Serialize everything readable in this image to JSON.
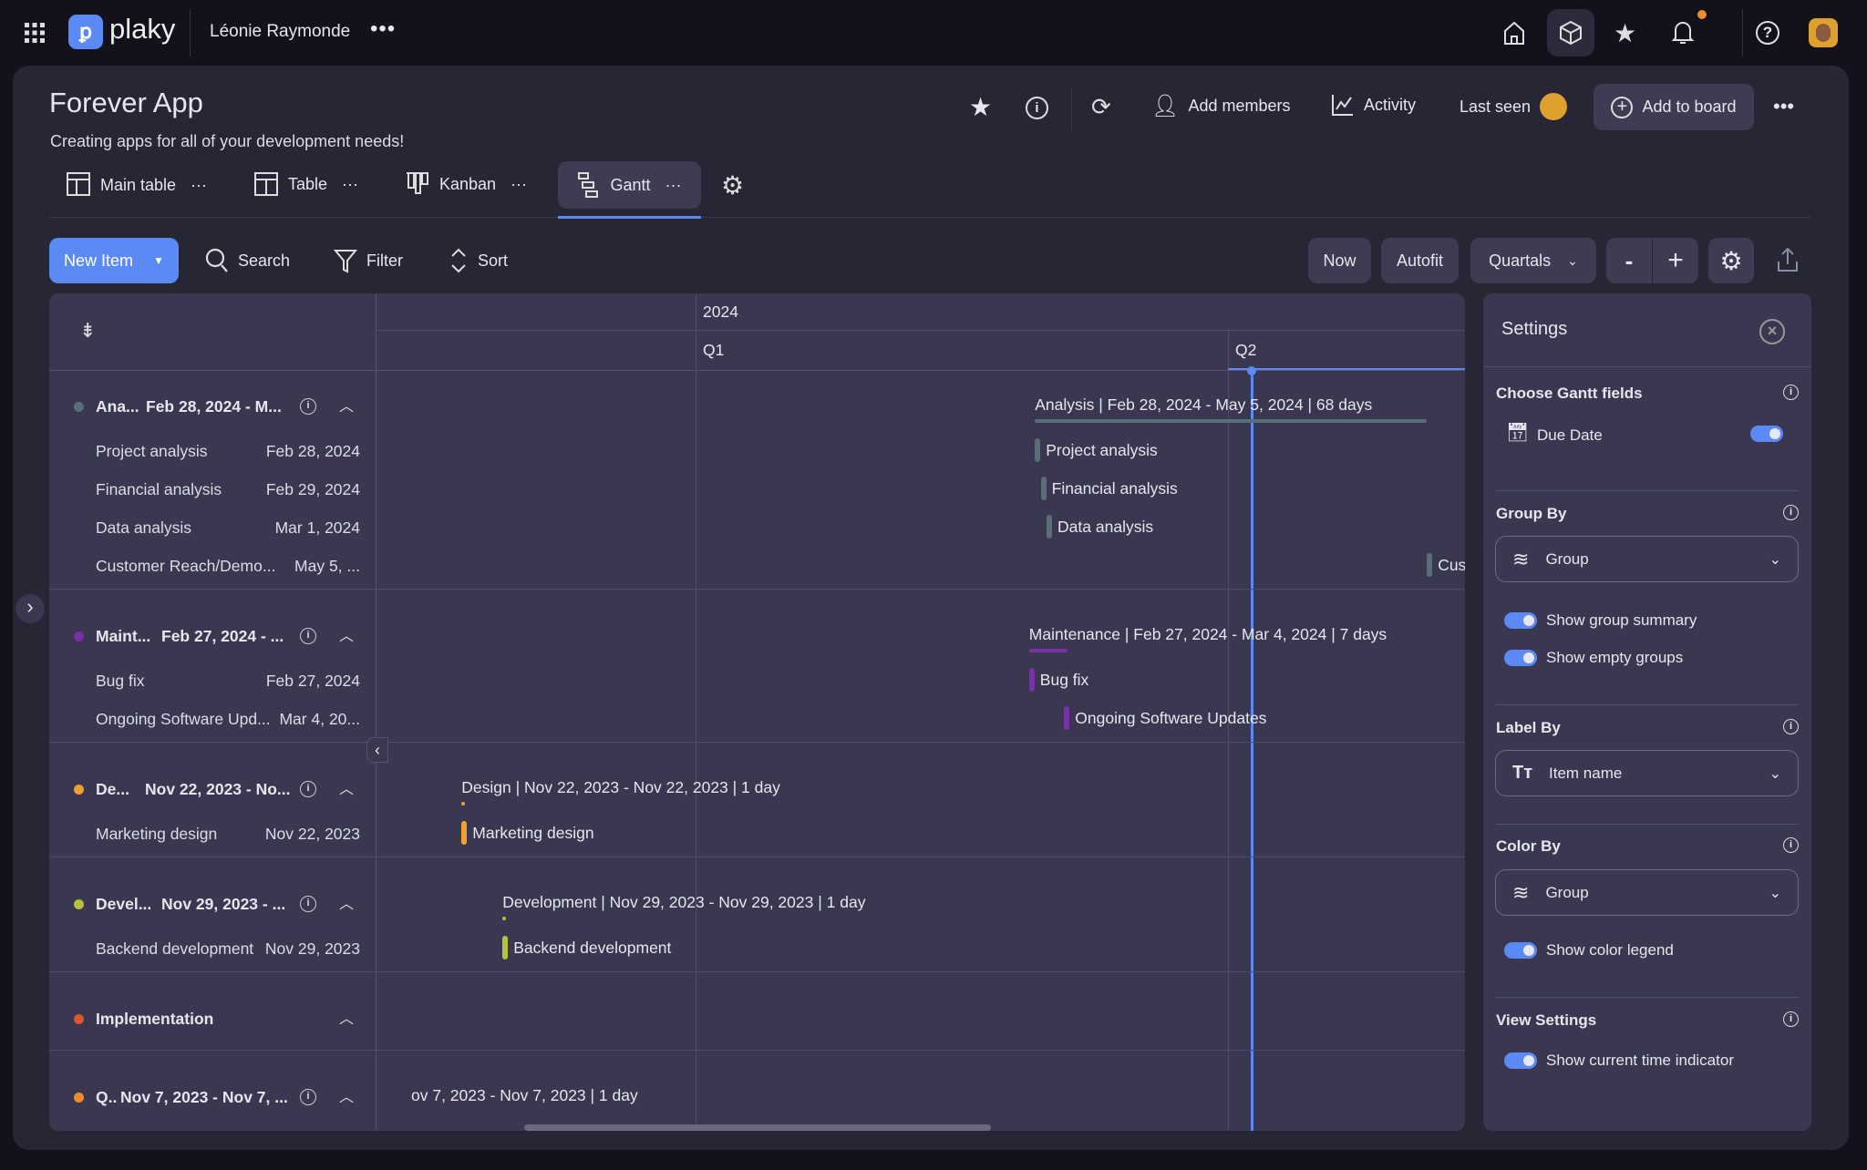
{
  "app": {
    "logo_text": "plaky",
    "workspace": "Léonie Raymonde"
  },
  "colors": {
    "accent": "#5b8af5",
    "notification": "#f08a2e"
  },
  "board": {
    "title": "Forever App",
    "description": "Creating apps for all of your development needs!",
    "actions": {
      "add_members": "Add members",
      "activity": "Activity",
      "last_seen": "Last seen",
      "add_to_board": "Add to board"
    }
  },
  "views": [
    {
      "label": "Main table",
      "icon": "main-table-icon"
    },
    {
      "label": "Table",
      "icon": "table-icon"
    },
    {
      "label": "Kanban",
      "icon": "kanban-icon"
    },
    {
      "label": "Gantt",
      "icon": "gantt-icon",
      "active": true
    }
  ],
  "toolbar": {
    "new_item": "New Item",
    "search": "Search",
    "filter": "Filter",
    "sort": "Sort",
    "now": "Now",
    "autofit": "Autofit",
    "scale": "Quartals",
    "zoom_out": "-",
    "zoom_in": "+"
  },
  "timeline": {
    "year": "2024",
    "quarters": [
      "Q1",
      "Q2"
    ],
    "current_date": "Apr 5, 2024"
  },
  "groups": [
    {
      "name": "Ana...",
      "dates": "Feb 28, 2024 - M...",
      "color": "#5a6e78",
      "summary": "Analysis | Feb 28, 2024 - May 5, 2024 | 68 days",
      "start": "Feb 28, 2024",
      "end": "May 5, 2024",
      "items": [
        {
          "name": "Project analysis",
          "date": "Feb 28, 2024"
        },
        {
          "name": "Financial analysis",
          "date": "Feb 29, 2024"
        },
        {
          "name": "Data analysis",
          "date": "Mar 1, 2024"
        },
        {
          "name": "Customer Reach/Demo...",
          "date": "May 5, ...",
          "chart_date": "May 5, 2024"
        }
      ]
    },
    {
      "name": "Maint...",
      "dates": "Feb 27, 2024 - ...",
      "color": "#7b2fa8",
      "summary": "Maintenance | Feb 27, 2024 - Mar 4, 2024 | 7 days",
      "start": "Feb 27, 2024",
      "end": "Mar 4, 2024",
      "items": [
        {
          "name": "Bug fix",
          "date": "Feb 27, 2024"
        },
        {
          "name": "Ongoing Software Upd...",
          "chart_name": "Ongoing Software Updates",
          "date": "Mar 4, 20...",
          "chart_date": "Mar 4, 2024"
        }
      ]
    },
    {
      "name": "De...",
      "dates": "Nov 22, 2023 - No...",
      "color": "#f0a030",
      "summary": "Design | Nov 22, 2023 - Nov 22, 2023 | 1 day",
      "start": "Nov 22, 2023",
      "end": "Nov 22, 2023",
      "items": [
        {
          "name": "Marketing design",
          "date": "Nov 22, 2023"
        }
      ]
    },
    {
      "name": "Devel...",
      "dates": "Nov 29, 2023 - ...",
      "color": "#b5c23a",
      "summary": "Development | Nov 29, 2023 - Nov 29, 2023 | 1 day",
      "start": "Nov 29, 2023",
      "end": "Nov 29, 2023",
      "items": [
        {
          "name": "Backend development",
          "date": "Nov 29, 2023"
        }
      ]
    },
    {
      "name": "Implementation",
      "dates": "",
      "color": "#e0552e",
      "summary": "",
      "items": []
    },
    {
      "name": "Q..",
      "dates": "Nov 7, 2023 - Nov 7, ...",
      "color": "#f08a2e",
      "summary": "ov 7, 2023 - Nov 7, 2023 | 1 day",
      "start": "Nov 7, 2023",
      "end": "Nov 7, 2023",
      "items": []
    }
  ],
  "settings": {
    "title": "Settings",
    "gantt_fields": {
      "label": "Choose Gantt fields",
      "field": "Due Date",
      "enabled": true
    },
    "group_by": {
      "label": "Group By",
      "value": "Group",
      "show_group_summary": "Show group summary",
      "show_empty_groups": "Show empty groups"
    },
    "label_by": {
      "label": "Label By",
      "value": "Item name"
    },
    "color_by": {
      "label": "Color By",
      "value": "Group",
      "show_color_legend": "Show color legend"
    },
    "view_settings": {
      "label": "View Settings",
      "show_current_time": "Show current time indicator"
    }
  }
}
